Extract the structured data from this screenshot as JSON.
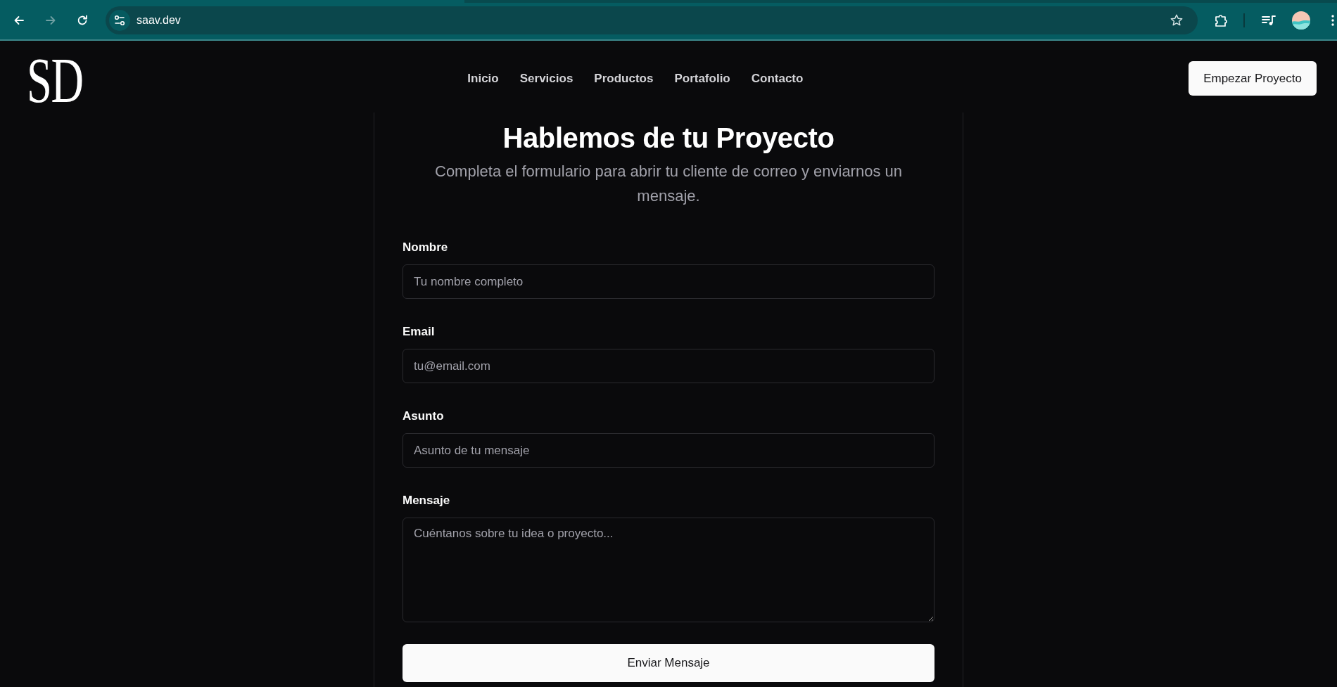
{
  "browser": {
    "url": "saav.dev",
    "forward_disabled": true
  },
  "header": {
    "logo": "SD",
    "nav": [
      {
        "label": "Inicio"
      },
      {
        "label": "Servicios"
      },
      {
        "label": "Productos"
      },
      {
        "label": "Portafolio"
      },
      {
        "label": "Contacto"
      }
    ],
    "cta": "Empezar Proyecto"
  },
  "form": {
    "title": "Hablemos de tu Proyecto",
    "subtitle": "Completa el formulario para abrir tu cliente de correo y enviarnos un mensaje.",
    "fields": [
      {
        "kind": "input",
        "label": "Nombre",
        "placeholder": "Tu nombre completo"
      },
      {
        "kind": "input",
        "label": "Email",
        "placeholder": "tu@email.com"
      },
      {
        "kind": "input",
        "label": "Asunto",
        "placeholder": "Asunto de tu mensaje"
      },
      {
        "kind": "textarea",
        "label": "Mensaje",
        "placeholder": "Cuéntanos sobre tu idea o proyecto..."
      }
    ],
    "submit": "Enviar Mensaje"
  }
}
